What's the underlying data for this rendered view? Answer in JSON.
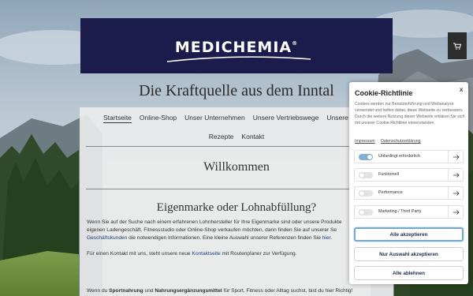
{
  "brand": {
    "logo_text": "MEDICHEMIA",
    "logo_mark": "®",
    "tagline": "Die Kraftquelle aus dem Inntal"
  },
  "colors": {
    "banner": "#1b1c4b",
    "link": "#1a3b8f",
    "cart_button": "#2d2d2d",
    "toggle_on": "#7fb0d6"
  },
  "cart": {
    "icon": "shopping-cart-icon"
  },
  "nav": {
    "row1": [
      {
        "label": "Startseite",
        "active": true
      },
      {
        "label": "Online-Shop"
      },
      {
        "label": "Unser Unternehmen"
      },
      {
        "label": "Unsere Vertriebswege"
      },
      {
        "label": "Unsere"
      }
    ],
    "row2": [
      {
        "label": "Rezepte"
      },
      {
        "label": "Kontakt"
      }
    ]
  },
  "main": {
    "heading": "Willkommen",
    "subheading": "Eigenmarke oder Lohnabfüllung?",
    "p1_a": "Wenn Sie auf der Suche nach einem erfahrenen Lohnhersteller für Ihre Eigenmarke sind oder unsere Produkte",
    "p1_b": "eigenen Ladengeschäft, Fitnessstudio oder Online-Shop verkaufen möchten, dann finden Sie auf unserer Se",
    "p1_link1": "Geschäftskunden",
    "p1_c": " die notwendigen Informationen. Eine kleine Auswahl unserer Referenzen finden Sie ",
    "p1_link2": "hier",
    "p1_d": ".",
    "p2_a": "Für einen Kontakt mit uns, steht unsere neue ",
    "p2_link": "Kontaktseite",
    "p2_b": " mit Routenplaner zur Verfügung.",
    "p3_a": "Wenn du ",
    "p3_b1": "Sportnahrung",
    "p3_c": " und ",
    "p3_b2": "Nahrungsergänzungsmittel",
    "p3_d": " für Sport, Fitness oder Alltag suchst, bist du hier Richtig!"
  },
  "cookie": {
    "title": "Cookie-Richtlinie",
    "close": "x",
    "text": "Cookies werden zur Benutzerführung und Webanalyse verwendet und helfen dabei, diese Webseite zu verbessern. Durch die weitere Nutzung dieser Webseite erklären Sie sich mit unserer Cookie-Richtlinie einverstanden.",
    "link_impressum": "Impressum",
    "link_datenschutz": "Datenschutzerklärung",
    "categories": [
      {
        "label": "Unbedingt erforderlich",
        "enabled": true
      },
      {
        "label": "Funktionell",
        "enabled": false
      },
      {
        "label": "Performance",
        "enabled": false
      },
      {
        "label": "Marketing / Third Party",
        "enabled": false
      }
    ],
    "btn_accept_all": "Alle akzeptieren",
    "btn_accept_selection": "Nur Auswahl akzeptieren",
    "btn_reject_all": "Alle ablehnen"
  }
}
